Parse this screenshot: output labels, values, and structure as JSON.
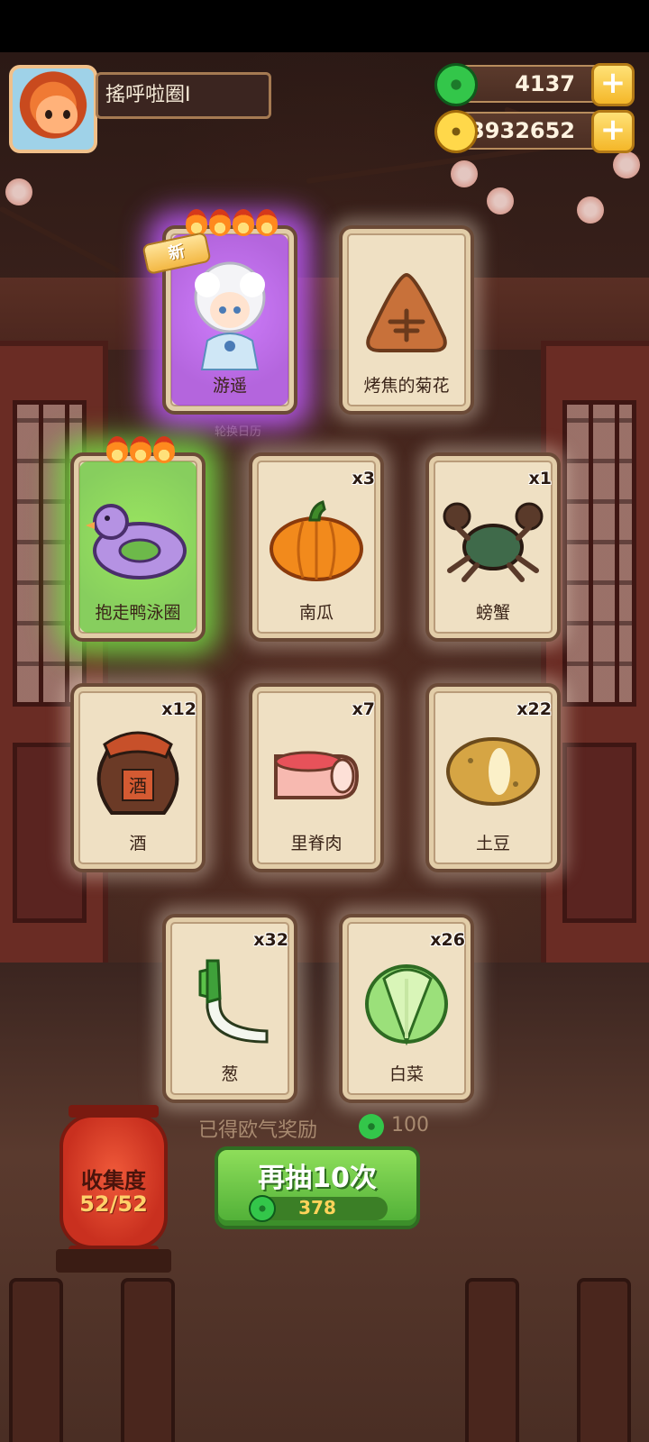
{
  "player": {
    "name": "搖呼啦圈I"
  },
  "currencies": {
    "jade": "4137",
    "coins": "13932652"
  },
  "cards": [
    {
      "label": "游遥",
      "qty": "",
      "icon": "white-haired-character-icon",
      "badge": "新",
      "rarity": "purple",
      "flames": 4
    },
    {
      "label": "烤焦的菊花",
      "qty": "",
      "icon": "burnt-chrysanthemum-icon",
      "badge": "",
      "rarity": "normal",
      "flames": 0
    },
    {
      "label": "抱走鸭泳圈",
      "qty": "",
      "icon": "duck-swim-ring-icon",
      "badge": "",
      "rarity": "green",
      "flames": 3
    },
    {
      "label": "南瓜",
      "qty": "x3",
      "icon": "pumpkin-icon",
      "badge": "",
      "rarity": "normal",
      "flames": 0
    },
    {
      "label": "螃蟹",
      "qty": "x1",
      "icon": "crab-icon",
      "badge": "",
      "rarity": "normal",
      "flames": 0
    },
    {
      "label": "酒",
      "qty": "x12",
      "icon": "wine-jar-icon",
      "badge": "",
      "rarity": "normal",
      "flames": 0
    },
    {
      "label": "里脊肉",
      "qty": "x7",
      "icon": "tenderloin-meat-icon",
      "badge": "",
      "rarity": "normal",
      "flames": 0
    },
    {
      "label": "土豆",
      "qty": "x22",
      "icon": "potato-icon",
      "badge": "",
      "rarity": "normal",
      "flames": 0
    },
    {
      "label": "葱",
      "qty": "x32",
      "icon": "green-onion-icon",
      "badge": "",
      "rarity": "normal",
      "flames": 0
    },
    {
      "label": "白菜",
      "qty": "x26",
      "icon": "cabbage-icon",
      "badge": "",
      "rarity": "normal",
      "flames": 0
    }
  ],
  "background_text": "轮换日历",
  "wine_jar_char": "酒",
  "reward": {
    "label": "已得欧气奖励",
    "value": "100"
  },
  "collection": {
    "title": "收集度",
    "count": "52/52"
  },
  "draw_button": {
    "label": "再抽10次",
    "cost": "378"
  },
  "colors": {
    "accent_green": "#4eae36",
    "gold": "#f4b729",
    "card_bg": "#efe0c3",
    "purple_glow": "#be5aff",
    "green_glow": "#78dc46"
  }
}
